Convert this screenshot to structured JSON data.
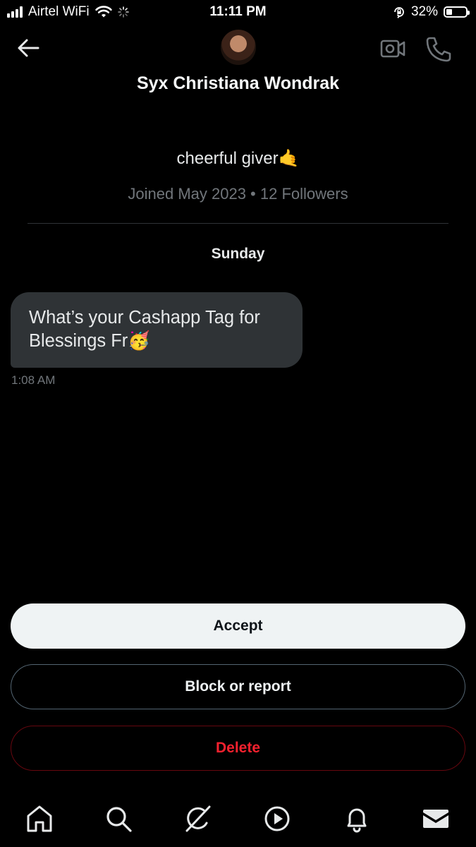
{
  "status_bar": {
    "carrier": "Airtel WiFi",
    "time": "11:11 PM",
    "battery": "32%",
    "battery_level": 0.32
  },
  "header": {
    "contact_name": "Syx Christiana Wondrak"
  },
  "profile": {
    "bio": "cheerful giver🤙",
    "meta": "Joined May 2023 • 12 Followers"
  },
  "conversation": {
    "day_label": "Sunday",
    "messages": [
      {
        "text_line1": "What’s your Cashapp Tag for",
        "text_line2": "Blessings Fr🥳",
        "time": "1:08 AM"
      }
    ]
  },
  "actions": {
    "accept": "Accept",
    "block": "Block or report",
    "delete": "Delete"
  },
  "bottom_nav": {
    "icons": [
      "home-icon",
      "search-icon",
      "grok-icon",
      "video-play-icon",
      "notifications-icon",
      "messages-icon"
    ]
  },
  "colors": {
    "background": "#000000",
    "bubble": "#2f3336",
    "muted": "#71767b",
    "danger": "#f4212e"
  }
}
